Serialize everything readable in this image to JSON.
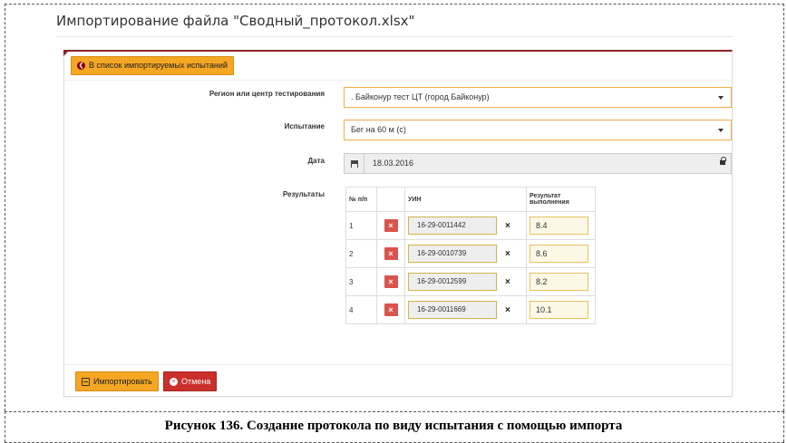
{
  "page": {
    "title": "Импортирование файла \"Сводный_протокол.xlsx\""
  },
  "toolbar": {
    "back_label": "В список импортируемых испытаний"
  },
  "form": {
    "region_label": "Регион или центр тестирования",
    "region_value": ". Байконур тест ЦТ (город Байконур)",
    "test_label": "Испытание",
    "test_value": "Бег на 60 м (с)",
    "date_label": "Дата",
    "date_value": "18.03.2016",
    "results_label": "Результаты"
  },
  "results_table": {
    "headers": {
      "num": "№ п/п",
      "uin": "УИН",
      "result": "Результат выполнения"
    },
    "rows": [
      {
        "num": "1",
        "uin": "16-29-0011442",
        "result": "8.4"
      },
      {
        "num": "2",
        "uin": "16-29-0010739",
        "result": "8.6"
      },
      {
        "num": "3",
        "uin": "16-29-0012599",
        "result": "8.2"
      },
      {
        "num": "4",
        "uin": "16-29-0011669",
        "result": "10.1"
      }
    ]
  },
  "footer": {
    "import_label": "Импортировать",
    "cancel_label": "Отмена"
  },
  "caption": "Рисунок 136. Создание протокола по виду испытания с помощью импорта",
  "colors": {
    "accent": "#f5a623",
    "danger": "#c9302c",
    "panel_top": "#8b2323"
  }
}
